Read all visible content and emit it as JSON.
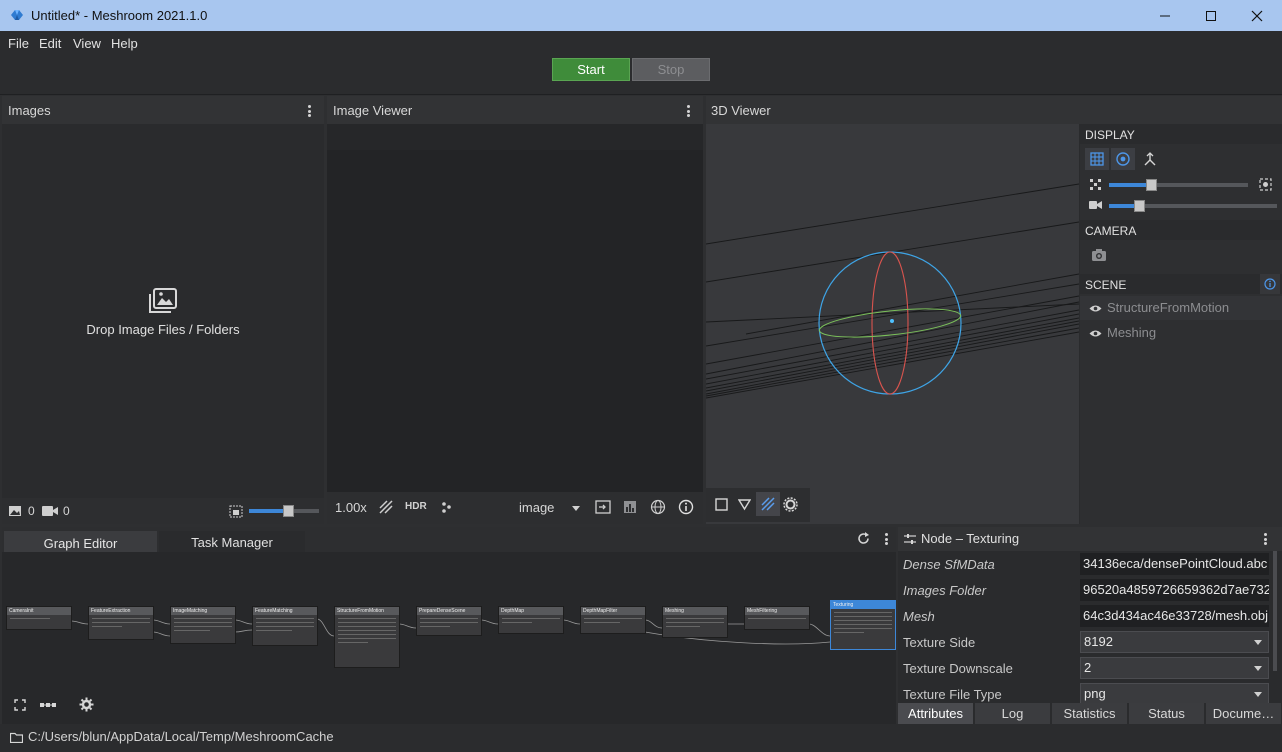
{
  "window": {
    "title": "Untitled* - Meshroom 2021.1.0",
    "minimize": "—",
    "maximize": "☐",
    "close": "✕"
  },
  "menu": [
    "File",
    "Edit",
    "View",
    "Help"
  ],
  "toolbar": {
    "start_label": "Start",
    "stop_label": "Stop"
  },
  "images_panel": {
    "title": "Images",
    "drop_text": "Drop Image Files / Folders",
    "image_count": "0",
    "camera_count": "0",
    "thumbnail_zoom": 0.55
  },
  "image_viewer": {
    "title": "Image Viewer",
    "zoom": "1.00x",
    "hdr_label": "HDR",
    "image_selector": "image"
  },
  "viewer3d": {
    "title": "3D Viewer",
    "display_label": "DISPLAY",
    "camera_label": "CAMERA",
    "scene_label": "SCENE",
    "point_size": 0.3,
    "camera_scale": 0.18,
    "scene_items": [
      "StructureFromMotion",
      "Meshing"
    ]
  },
  "graph_editor": {
    "tabs": [
      "Graph Editor",
      "Task Manager"
    ],
    "nodes": [
      "CameraInit",
      "FeatureExtraction",
      "ImageMatching",
      "FeatureMatching",
      "StructureFromMotion",
      "PrepareDenseScene",
      "DepthMap",
      "DepthMapFilter",
      "Meshing",
      "MeshFiltering",
      "Texturing"
    ]
  },
  "node_panel": {
    "title": "Node – Texturing",
    "attributes": [
      {
        "name": "Dense SfMData",
        "value": "34136eca/densePointCloud.abc",
        "italic": true,
        "kind": "text"
      },
      {
        "name": "Images Folder",
        "value": "96520a4859726659362d7ae732",
        "italic": true,
        "kind": "text"
      },
      {
        "name": "Mesh",
        "value": "64c3d434ac46e33728/mesh.obj",
        "italic": true,
        "kind": "text"
      },
      {
        "name": "Texture Side",
        "value": "8192",
        "italic": false,
        "kind": "combo"
      },
      {
        "name": "Texture Downscale",
        "value": "2",
        "italic": false,
        "kind": "combo"
      },
      {
        "name": "Texture File Type",
        "value": "png",
        "italic": false,
        "kind": "combo"
      }
    ],
    "tabs": [
      "Attributes",
      "Log",
      "Statistics",
      "Status",
      "Docume…"
    ]
  },
  "statusbar": {
    "path": "C:/Users/blun/AppData/Local/Temp/MeshroomCache"
  },
  "colors": {
    "accent": "#3d87d8",
    "start_green": "#3f8c3a",
    "titlebar": "#a8c6ef"
  }
}
